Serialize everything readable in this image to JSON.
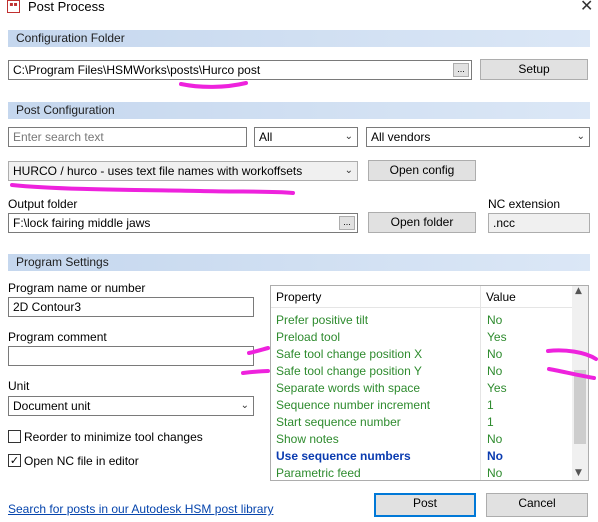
{
  "window": {
    "title": "Post Process",
    "close_glyph": "✕",
    "icon": "app-icon"
  },
  "sections": {
    "configuration_folder": "Configuration Folder",
    "post_configuration": "Post Configuration",
    "program_settings": "Program Settings"
  },
  "config_folder": {
    "path": "C:\\Program Files\\HSMWorks\\posts\\Hurco post",
    "browse_label": "...",
    "setup_label": "Setup"
  },
  "post_config": {
    "search_placeholder": "Enter search text",
    "filter_all": "All",
    "vendor_filter": "All vendors",
    "selected_post": "HURCO / hurco - uses text file names with workoffsets",
    "open_config_label": "Open config",
    "output_folder_label": "Output folder",
    "output_folder_value": "F:\\lock fairing middle jaws",
    "browse_label": "...",
    "open_folder_label": "Open folder",
    "nc_extension_label": "NC extension",
    "nc_extension_value": ".ncc"
  },
  "program_settings": {
    "program_name_label": "Program name or number",
    "program_name_value": "2D Contour3",
    "program_comment_label": "Program comment",
    "program_comment_value": "",
    "unit_label": "Unit",
    "unit_value": "Document unit",
    "reorder_label": "Reorder to minimize tool changes",
    "reorder_checked": false,
    "open_nc_label": "Open NC file in editor",
    "open_nc_checked": true,
    "check_glyph": "✓"
  },
  "property_grid": {
    "header_property": "Property",
    "header_value": "Value",
    "rows": [
      {
        "property": "Prefer positive tilt",
        "value": "No"
      },
      {
        "property": "Preload tool",
        "value": "Yes"
      },
      {
        "property": "Safe tool change position X",
        "value": "No"
      },
      {
        "property": "Safe tool change position Y",
        "value": "No"
      },
      {
        "property": "Separate words with space",
        "value": "Yes"
      },
      {
        "property": "Sequence number increment",
        "value": "1"
      },
      {
        "property": "Start sequence number",
        "value": "1"
      },
      {
        "property": "Show notes",
        "value": "No"
      },
      {
        "property": "Use sequence numbers",
        "value": "No",
        "bold": true
      },
      {
        "property": "Parametric feed",
        "value": "No"
      }
    ]
  },
  "footer": {
    "library_link": "Search for posts in our Autodesk HSM post library",
    "post_label": "Post",
    "cancel_label": "Cancel"
  },
  "colors": {
    "section_bg": "#c5d7ee",
    "property_green": "#2e8b2e",
    "highlight_blue": "#0a3bb0",
    "annotation_magenta": "#ee22dd",
    "accent": "#0078d7"
  }
}
